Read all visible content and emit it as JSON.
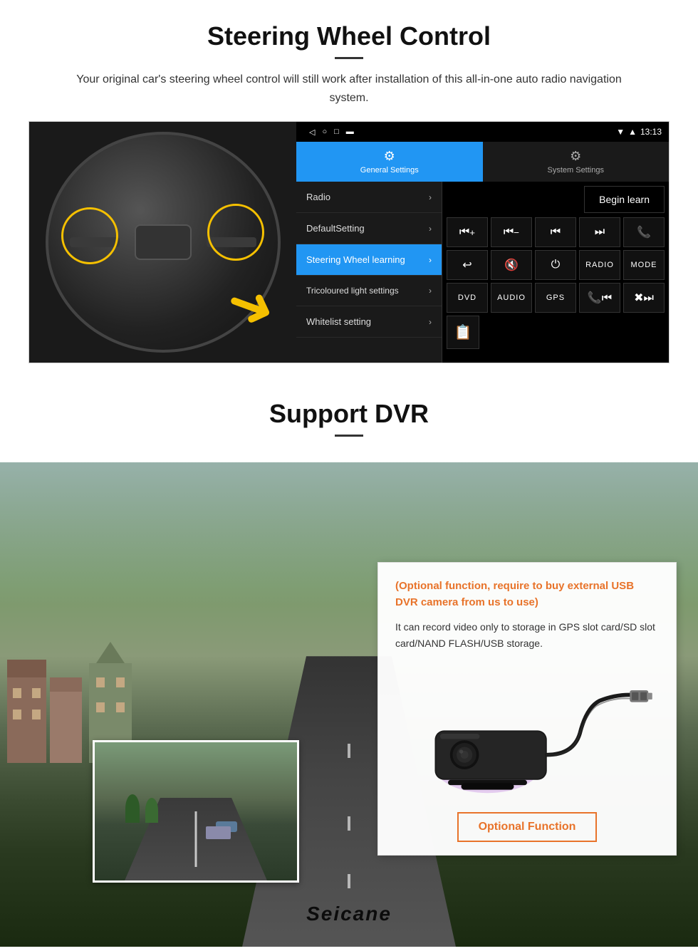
{
  "steering_section": {
    "title": "Steering Wheel Control",
    "description": "Your original car's steering wheel control will still work after installation of this all-in-one auto radio navigation system.",
    "status_bar": {
      "time": "13:13",
      "signal_icons": "▼ ▲"
    },
    "tabs": [
      {
        "label": "General Settings",
        "icon": "⚙",
        "active": true
      },
      {
        "label": "System Settings",
        "icon": "🔧",
        "active": false
      }
    ],
    "menu_items": [
      {
        "label": "Radio",
        "active": false
      },
      {
        "label": "DefaultSetting",
        "active": false
      },
      {
        "label": "Steering Wheel learning",
        "active": true
      },
      {
        "label": "Tricoloured light settings",
        "active": false
      },
      {
        "label": "Whitelist setting",
        "active": false
      }
    ],
    "begin_learn_label": "Begin learn",
    "control_buttons": [
      {
        "label": "⏮+",
        "row": 1
      },
      {
        "label": "⏮−",
        "row": 1
      },
      {
        "label": "⏮⏮",
        "row": 1
      },
      {
        "label": "⏭⏭",
        "row": 1
      },
      {
        "label": "📞",
        "row": 1
      },
      {
        "label": "↩",
        "row": 2
      },
      {
        "label": "🔇",
        "row": 2
      },
      {
        "label": "⏻",
        "row": 2
      },
      {
        "label": "RADIO",
        "row": 2
      },
      {
        "label": "MODE",
        "row": 2
      },
      {
        "label": "DVD",
        "row": 3
      },
      {
        "label": "AUDIO",
        "row": 3
      },
      {
        "label": "GPS",
        "row": 3
      },
      {
        "label": "📞⏮",
        "row": 3
      },
      {
        "label": "✖⏭",
        "row": 3
      }
    ]
  },
  "dvr_section": {
    "title": "Support DVR",
    "optional_text": "(Optional function, require to buy external USB DVR camera from us to use)",
    "description": "It can record video only to storage in GPS slot card/SD slot card/NAND FLASH/USB storage.",
    "optional_function_label": "Optional Function",
    "seicane_brand": "Seicane"
  }
}
